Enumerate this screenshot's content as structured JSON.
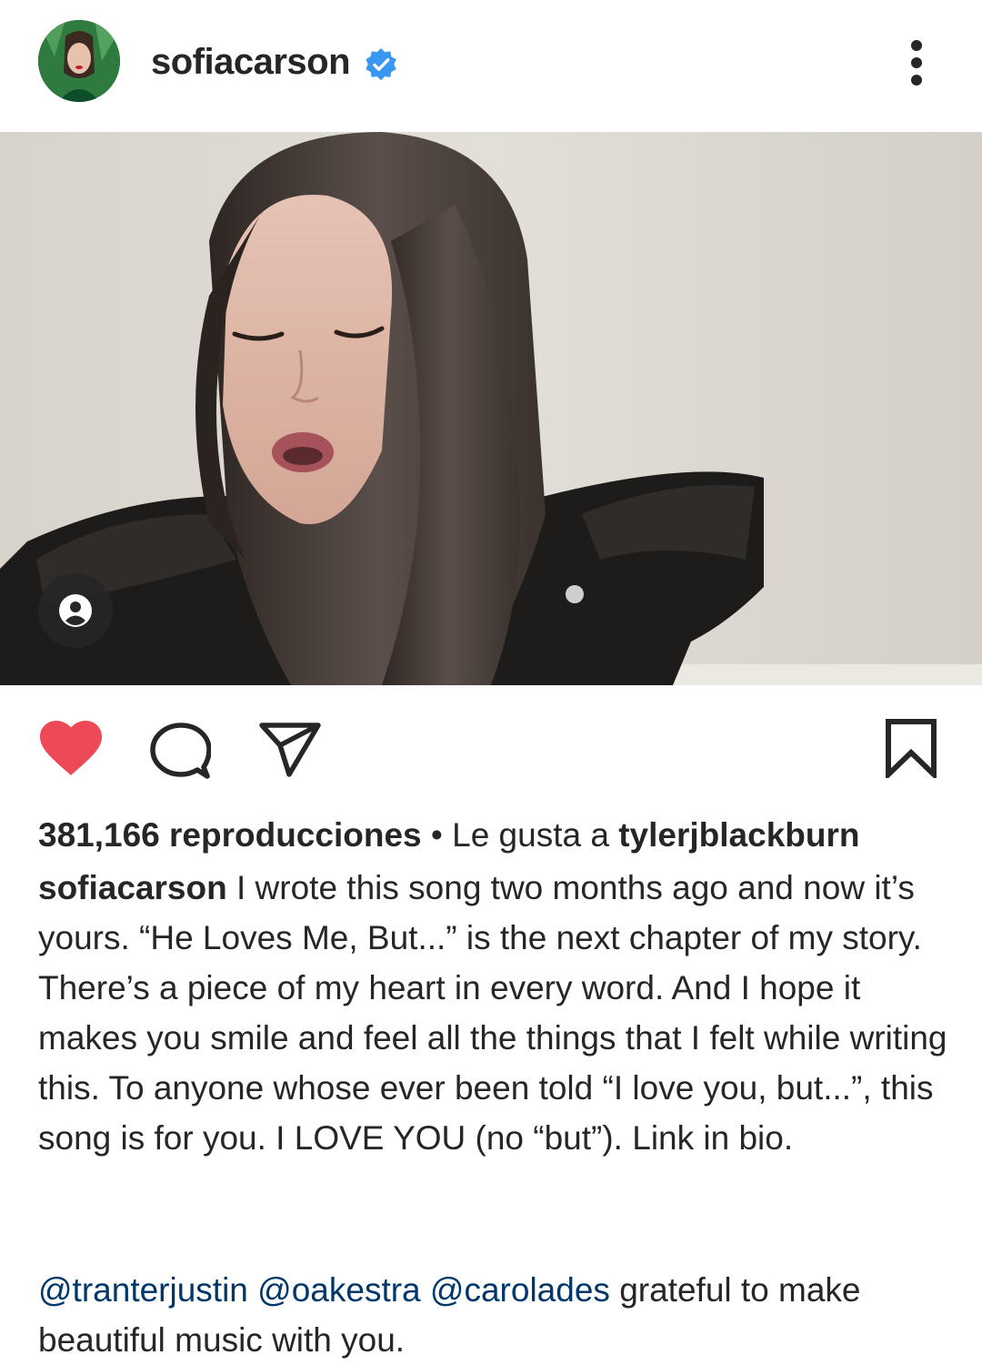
{
  "header": {
    "username": "sofiacarson",
    "verified": true,
    "more_icon": "more-vertical-icon"
  },
  "media": {
    "tag_icon": "person-icon"
  },
  "actions": {
    "like_icon": "heart-icon",
    "liked": true,
    "comment_icon": "comment-icon",
    "share_icon": "send-icon",
    "save_icon": "bookmark-icon"
  },
  "meta": {
    "views": "381,166 reproducciones",
    "separator": " • ",
    "liked_by_prefix": "Le gusta a ",
    "liked_by_user": "tylerjblackburn"
  },
  "caption": {
    "username": "sofiacarson",
    "text": "I wrote this song two months ago and now it’s yours. “He Loves Me, But...” is the next chapter of my story. There’s a piece of my heart in every word. And I hope it makes you smile and feel all the things that I felt while writing this. To anyone whose ever been told “I love you, but...”, this song is for you. I LOVE YOU (no “but”). Link in bio.",
    "mentions": [
      "@tranterjustin",
      "@oakestra",
      "@carolades"
    ],
    "mentions_tail": "grateful to make beautiful music with you."
  },
  "colors": {
    "like": "#ed4956",
    "verified": "#3897f0",
    "mention": "#00376b",
    "text": "#262626"
  }
}
